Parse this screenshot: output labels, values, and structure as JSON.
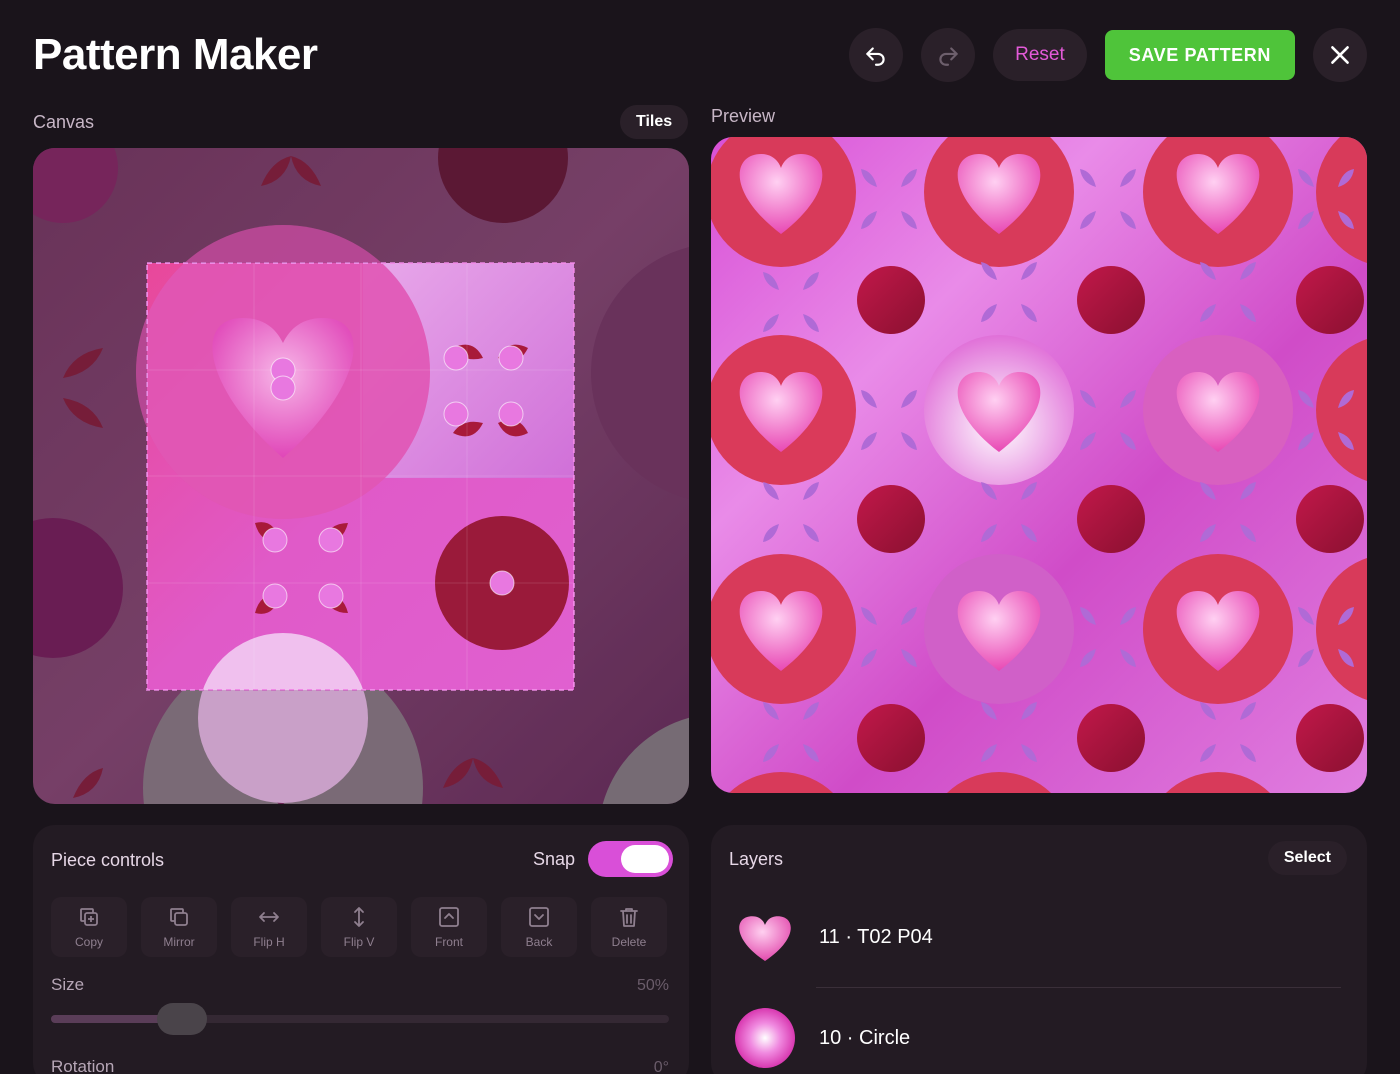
{
  "app": {
    "title": "Pattern Maker"
  },
  "header": {
    "reset_label": "Reset",
    "save_label": "SAVE PATTERN"
  },
  "canvas_section": {
    "label": "Canvas",
    "tiles_label": "Tiles"
  },
  "preview_section": {
    "label": "Preview"
  },
  "piece_controls": {
    "title": "Piece controls",
    "snap_label": "Snap",
    "snap_on": true,
    "tools": [
      {
        "label": "Copy",
        "icon": "copy-icon"
      },
      {
        "label": "Mirror",
        "icon": "mirror-icon"
      },
      {
        "label": "Flip H",
        "icon": "flip-h-icon"
      },
      {
        "label": "Flip V",
        "icon": "flip-v-icon"
      },
      {
        "label": "Front",
        "icon": "bring-front-icon"
      },
      {
        "label": "Back",
        "icon": "send-back-icon"
      },
      {
        "label": "Delete",
        "icon": "trash-icon"
      }
    ],
    "size": {
      "label": "Size",
      "value": "50%",
      "fraction": 0.5
    },
    "rotation": {
      "label": "Rotation",
      "value": "0°"
    }
  },
  "layers": {
    "title": "Layers",
    "select_label": "Select",
    "items": [
      {
        "name": "11 · T02 P04",
        "icon": "heart-icon"
      },
      {
        "name": "10 · Circle",
        "icon": "circle-icon"
      }
    ]
  },
  "colors": {
    "accent": "#d94fd8",
    "save": "#4fc43a",
    "background": "#1a141b"
  }
}
